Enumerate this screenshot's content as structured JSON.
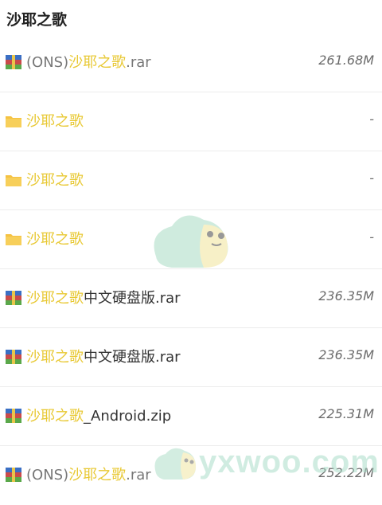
{
  "header": {
    "title": "沙耶之歌"
  },
  "files": [
    {
      "icon": "archive-icon",
      "prefix": "(ONS)",
      "highlight": "沙耶之歌",
      "suffix": ".rar",
      "size": "261.68M"
    },
    {
      "icon": "folder-icon",
      "prefix": "",
      "highlight": "沙耶之歌",
      "suffix": "",
      "size": "-"
    },
    {
      "icon": "folder-icon",
      "prefix": "",
      "highlight": "沙耶之歌",
      "suffix": "",
      "size": "-"
    },
    {
      "icon": "folder-icon",
      "prefix": "",
      "highlight": "沙耶之歌",
      "suffix": "",
      "size": "-"
    },
    {
      "icon": "archive-icon",
      "prefix": "",
      "highlight": "沙耶之歌",
      "suffix": "中文硬盘版.rar",
      "size": "236.35M"
    },
    {
      "icon": "archive-icon",
      "prefix": "",
      "highlight": "沙耶之歌",
      "suffix": "中文硬盘版.rar",
      "size": "236.35M"
    },
    {
      "icon": "archive-icon",
      "prefix": "",
      "highlight": "沙耶之歌",
      "suffix": "_Android.zip",
      "size": "225.31M"
    },
    {
      "icon": "archive-icon",
      "prefix": "(ONS)",
      "highlight": "沙耶之歌",
      "suffix": ".rar",
      "size": "252.22M"
    }
  ],
  "watermark": {
    "text": "yxwoo.com"
  },
  "colors": {
    "highlight": "#e8c832",
    "folder": "#f5c242",
    "watermark": "#aadcc8"
  }
}
